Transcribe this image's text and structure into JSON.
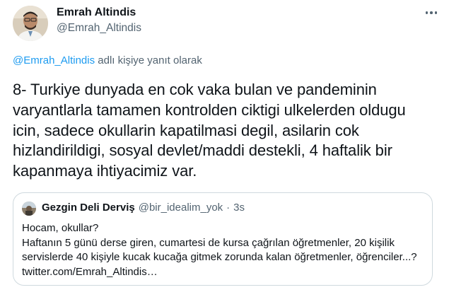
{
  "author": {
    "name": "Emrah Altindis",
    "handle": "@Emrah_Altindis",
    "avatar_icon": "profile-photo"
  },
  "menu": {
    "icon": "more-horizontal-icon"
  },
  "reply_context": {
    "mention": "@Emrah_Altindis",
    "suffix": " adlı kişiye yanıt olarak"
  },
  "tweet": {
    "text": "8- Turkiye dunyada en cok vaka bulan ve pandeminin varyantlarla tamamen kontrolden ciktigi ulkelerden oldugu icin, sadece okullarin kapatilmasi degil, asilarin cok hizlandirildigi, sosyal devlet/maddi destekli, 4 haftalik bir kapanmaya ihtiyacimiz var."
  },
  "quoted_tweet": {
    "author_name": "Gezgin Deli Derviş",
    "author_handle": "@bir_idealim_yok",
    "separator": "·",
    "time": "3s",
    "line1": "Hocam, okullar?",
    "line2": "Haftanın 5 günü derse giren, cumartesi  de kursa çağrılan öğretmenler, 20 kişilik servislerde 40 kişiyle kucak kucağa gitmek zorunda kalan öğretmenler, öğrenciler...? twitter.com/Emrah_Altindis…"
  },
  "colors": {
    "text": "#0f1419",
    "secondary": "#536471",
    "link": "#1d9bf0",
    "border": "#cfd9de"
  }
}
